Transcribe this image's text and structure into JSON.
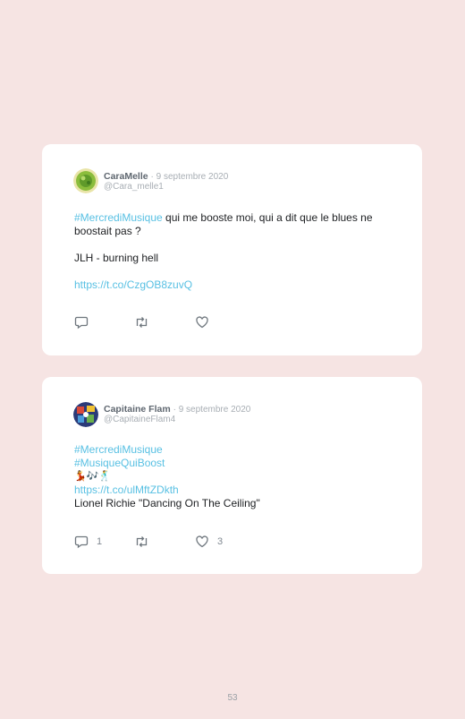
{
  "tweets": [
    {
      "author": "CaraMelle",
      "date": "· 9 septembre 2020",
      "handle": "@Cara_melle1",
      "hashtag": "#MercrediMusique",
      "text_after_hashtag": " qui me booste moi, qui a dit que le blues ne boostait pas ?",
      "line2": "JLH - burning hell",
      "link": "https://t.co/CzgOB8zuvQ",
      "reply_count": "",
      "like_count": ""
    },
    {
      "author": "Capitaine Flam",
      "date": "· 9 septembre 2020",
      "handle": "@CapitaineFlam4",
      "hashtag1": "#MercrediMusique",
      "hashtag2": "#MusiqueQuiBoost",
      "emojis": "💃🎶🕺",
      "link": "https://t.co/ulMftZDkth",
      "text": "Lionel Richie \"Dancing On The Ceiling\"",
      "reply_count": "1",
      "like_count": "3"
    }
  ],
  "page_number": "53",
  "icons": [
    "reply-icon",
    "retweet-icon",
    "like-icon"
  ],
  "colors": {
    "background": "#f6e4e3",
    "link": "#58c0e3",
    "card": "#ffffff"
  }
}
